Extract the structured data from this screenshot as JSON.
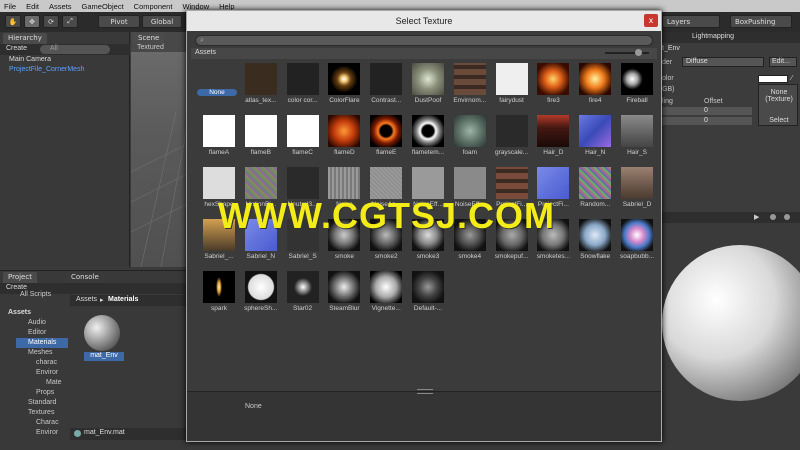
{
  "menubar": [
    "File",
    "Edit",
    "Assets",
    "GameObject",
    "Component",
    "Window",
    "Help"
  ],
  "toolbar": {
    "pivot_label": "Pivot",
    "global_label": "Global",
    "layers_label": "Layers",
    "layout_label": "BoxPushing"
  },
  "hierarchy": {
    "tab_label": "Hierarchy",
    "create_label": "Create",
    "search_placeholder": "All",
    "items": [
      "Main Camera",
      "ProjectFile_CornerMesh"
    ]
  },
  "scene": {
    "tab_label": "Scene",
    "mode_label": "Textured"
  },
  "dialog": {
    "title": "Select Texture",
    "close_label": "x",
    "section_label": "Assets",
    "bottom_label": "None",
    "textures": [
      "None",
      "atlas_tex...",
      "color cor...",
      "ColorFlare",
      "Contrast...",
      "DustPoof",
      "Envirnom...",
      "fairydust",
      "fire3",
      "fire4",
      "Fireball",
      "flameA",
      "flameB",
      "flameC",
      "flameD",
      "flameE",
      "flametem...",
      "foam",
      "grayscale...",
      "Hair_D",
      "Hair_N",
      "Hair_S",
      "hexShape",
      "MotionBl...",
      "Neutral3...",
      "Noise",
      "NoiseAn...",
      "NoiseEff...",
      "NoiseEff...",
      "ProjectFi...",
      "ProjectFi...",
      "Random...",
      "Sabriel_D",
      "Sabriel_...",
      "Sabriel_N",
      "Sabriel_S",
      "smoke",
      "smoke2",
      "smoke3",
      "smoke4",
      "smokepuf...",
      "smoketes...",
      "Snowflake",
      "soapbubb...",
      "spark",
      "sphereSh...",
      "Star02",
      "SteamBlur",
      "Vignette...",
      "Default-..."
    ]
  },
  "inspector": {
    "header_label": "Lightmapping",
    "material_name": "t_Env",
    "shader_label": "der",
    "shader_value": "Diffuse",
    "edit_label": "Edit...",
    "color_label": "olor",
    "rgb_label": "GB)",
    "tiling_label": "ling",
    "offset_label": "Offset",
    "offset_x": "0",
    "offset_y": "0",
    "texture_none": "None\n(Texture)",
    "select_label": "Select"
  },
  "project": {
    "tab_label": "Project",
    "console_label": "Console",
    "create_label": "Create",
    "filter_label": "All Scripts",
    "breadcrumb_root": "Assets",
    "breadcrumb_sep": "▸",
    "breadcrumb_leaf": "Materials",
    "tree": [
      "Assets",
      "Audio",
      "Editor",
      "Materials",
      "Meshes",
      "charac",
      "Enviror",
      "Mate",
      "Props",
      "Standard",
      "Textures",
      "Charac",
      "Enviror"
    ],
    "asset_name": "mat_Env",
    "footer_label": "mat_Env.mat"
  },
  "watermark": "WWW.CGTSJ.COM"
}
